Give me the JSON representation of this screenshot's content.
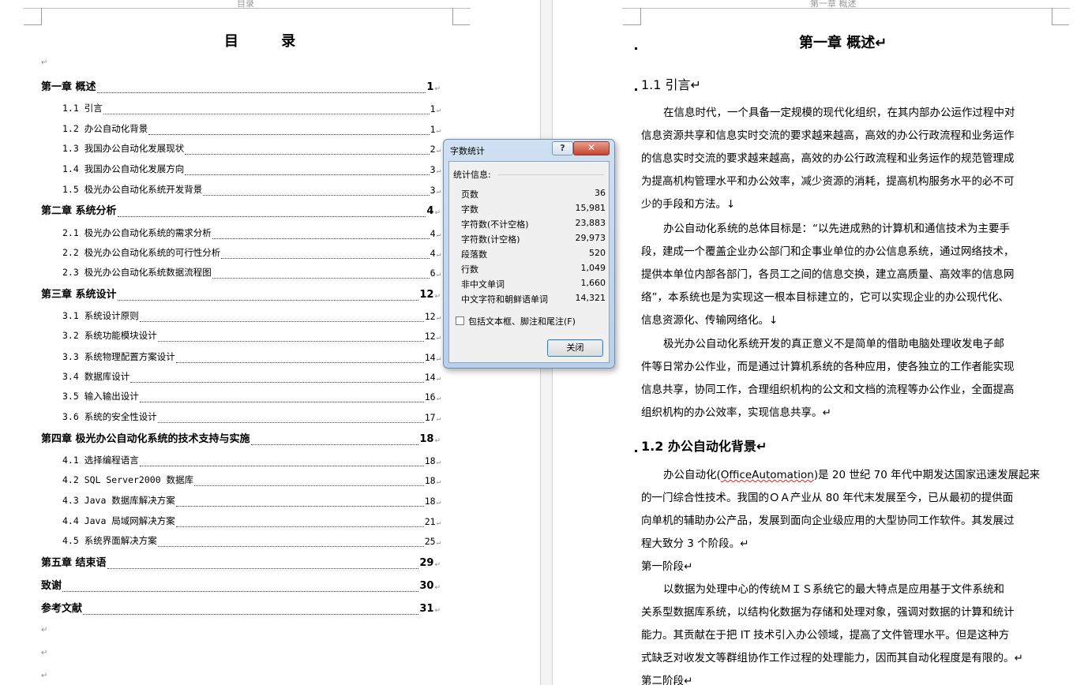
{
  "left_page": {
    "header_label": "目录",
    "toc_title": "目  录",
    "para_mark": "↵",
    "toc": [
      {
        "level": 1,
        "text": "第一章  概述",
        "page": "1"
      },
      {
        "level": 2,
        "text": "1.1 引言",
        "page": "1"
      },
      {
        "level": 2,
        "text": "1.2 办公自动化背景",
        "page": "1"
      },
      {
        "level": 2,
        "text": "1.3 我国办公自动化发展现状",
        "page": "2"
      },
      {
        "level": 2,
        "text": "1.4 我国办公自动化发展方向",
        "page": "3"
      },
      {
        "level": 2,
        "text": "1.5 极光办公自动化系统开发背景",
        "page": "3"
      },
      {
        "level": 1,
        "text": "第二章  系统分析",
        "page": "4"
      },
      {
        "level": 2,
        "text": "2.1 极光办公自动化系统的需求分析",
        "page": "4"
      },
      {
        "level": 2,
        "text": "2.2 极光办公自动化系统的可行性分析",
        "page": "4"
      },
      {
        "level": 2,
        "text": "2.3 极光办公自动化系统数据流程图",
        "page": "6"
      },
      {
        "level": 1,
        "text": "第三章  系统设计",
        "page": "12"
      },
      {
        "level": 2,
        "text": "3.1 系统设计原则",
        "page": "12"
      },
      {
        "level": 2,
        "text": "3.2 系统功能模块设计",
        "page": "12"
      },
      {
        "level": 2,
        "text": "3.3 系统物理配置方案设计",
        "page": "14"
      },
      {
        "level": 2,
        "text": "3.4 数据库设计",
        "page": "14"
      },
      {
        "level": 2,
        "text": "3.5 输入输出设计",
        "page": "16"
      },
      {
        "level": 2,
        "text": "3.6 系统的安全性设计",
        "page": "17"
      },
      {
        "level": 1,
        "text": "第四章  极光办公自动化系统的技术支持与实施",
        "page": "18"
      },
      {
        "level": 2,
        "text": "4.1 选择编程语言",
        "page": "18"
      },
      {
        "level": 2,
        "text": "4.2 SQL Server2000 数据库",
        "page": "18"
      },
      {
        "level": 2,
        "text": "4.3 Java 数据库解决方案",
        "page": "18"
      },
      {
        "level": 2,
        "text": "4.4 Java 局域网解决方案",
        "page": "21"
      },
      {
        "level": 2,
        "text": "4.5 系统界面解决方案",
        "page": "25"
      },
      {
        "level": 1,
        "text": "第五章  结束语",
        "page": "29"
      },
      {
        "level": 1,
        "text": "致谢",
        "page": "30"
      },
      {
        "level": 1,
        "text": "参考文献",
        "page": "31"
      }
    ]
  },
  "dialog": {
    "title": "字数统计",
    "help": "?",
    "close_x": "✕",
    "group_label": "统计信息:",
    "stats": [
      {
        "label": "页数",
        "value": "36"
      },
      {
        "label": "字数",
        "value": "15,981"
      },
      {
        "label": "字符数(不计空格)",
        "value": "23,883"
      },
      {
        "label": "字符数(计空格)",
        "value": "29,973"
      },
      {
        "label": "段落数",
        "value": "520"
      },
      {
        "label": "行数",
        "value": "1,049"
      },
      {
        "label": "非中文单词",
        "value": "1,660"
      },
      {
        "label": "中文字符和朝鲜语单词",
        "value": "14,321"
      }
    ],
    "checkbox_label": "包括文本框、脚注和尾注(F)",
    "checkbox_checked": false,
    "close_button": "关闭"
  },
  "right_page": {
    "header_label": "第一章  概述",
    "chapter_title": "第一章   概述↵",
    "section_1_1": "1.1   引言↵",
    "para1": [
      "在信息时代，一个具备一定规模的现代化组织，在其内部办公运作过程中对",
      "信息资源共享和信息实时交流的要求越来越高，高效的办公行政流程和业务运作",
      "的信息实时交流的要求越来越高，高效的办公行政流程和业务运作的规范管理成",
      "为提高机构管理水平和办公效率，减少资源的消耗，提高机构服务水平的必不可",
      "少的手段和方法。↓"
    ],
    "para2": [
      " 办公自动化系统的总体目标是：“以先进成熟的计算机和通信技术为主要手",
      "段，建成一个覆盖企业办公部门和企事业单位的办公信息系统，通过网络技术，",
      "提供本单位内部各部门，各员工之间的信息交换，建立高质量、高效率的信息网",
      "络”，本系统也是为实现这一根本目标建立的，它可以实现企业的办公现代化、",
      "信息资源化、传输网络化。↓"
    ],
    "para3": [
      "极光办公自动化系统开发的真正意义不是简单的借助电脑处理收发电子邮",
      "件等日常办公作业，而是通过计算机系统的各种应用，使各独立的工作者能实现",
      "信息共享，协同工作，合理组织机构的公文和文档的流程等办公作业，全面提高",
      "组织机构的办公效率，实现信息共享。↵"
    ],
    "section_1_2": "1.2 办公自动化背景↵",
    "para4_first_a": "办公自动化(",
    "para4_first_word": "OfficeAutomation",
    "para4_first_b": ")是 20 世纪 70 年代中期发达国家迅速发展起来",
    "para4": [
      "的一门综合性技术。我国的ＯＡ产业从 80 年代末发展至今，已从最初的提供面",
      "向单机的辅助办公产品，发展到面向企业级应用的大型协同工作软件。其发展过",
      "程大致分 3 个阶段。↵"
    ],
    "stage1": "第一阶段↵",
    "para5": [
      "以数据为处理中心的传统ＭＩＳ系统它的最大特点是应用基于文件系统和",
      "关系型数据库系统，以结构化数据为存储和处理对象，强调对数据的计算和统计",
      "能力。其贡献在于把 IT 技术引入办公领域，提高了文件管理水平。但是这种方",
      "式缺乏对收发文等群组协作工作过程的处理能力，因而其自动化程度是有限的。↵"
    ],
    "stage2": "第二阶段↵"
  }
}
